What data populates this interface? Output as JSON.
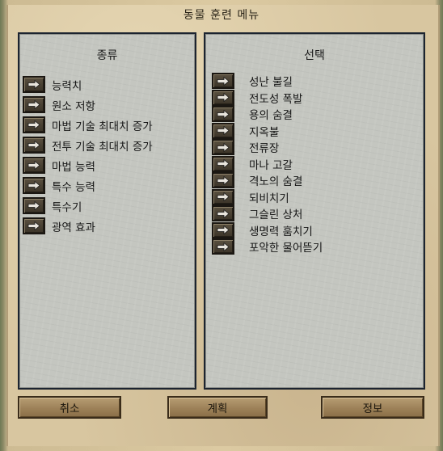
{
  "window": {
    "title": "동물 훈련 메뉴"
  },
  "left_panel": {
    "heading": "종류",
    "items": [
      {
        "label": "능력치"
      },
      {
        "label": "원소 저항"
      },
      {
        "label": "마법 기술 최대치 증가"
      },
      {
        "label": "전투 기술 최대치 증가"
      },
      {
        "label": "마법 능력"
      },
      {
        "label": "특수 능력"
      },
      {
        "label": "특수기"
      },
      {
        "label": "광역 효과"
      }
    ]
  },
  "right_panel": {
    "heading": "선택",
    "items": [
      {
        "label": "성난 불길"
      },
      {
        "label": "전도성 폭발"
      },
      {
        "label": "용의 숨결"
      },
      {
        "label": "지옥불"
      },
      {
        "label": "전류장"
      },
      {
        "label": "마나 고갈"
      },
      {
        "label": "격노의 숨결"
      },
      {
        "label": "되비치기"
      },
      {
        "label": "그슬린 상처"
      },
      {
        "label": "생명력 훔치기"
      },
      {
        "label": "포악한 물어뜯기"
      }
    ]
  },
  "buttons": {
    "cancel": "취소",
    "plan": "계획",
    "info": "정보"
  },
  "icons": {
    "item_icon": "arrow-right-icon"
  },
  "colors": {
    "parchment": "#d8c6a0",
    "panel": "#c4c6c0",
    "panel_border": "#1c2430",
    "button": "#9d8158"
  }
}
